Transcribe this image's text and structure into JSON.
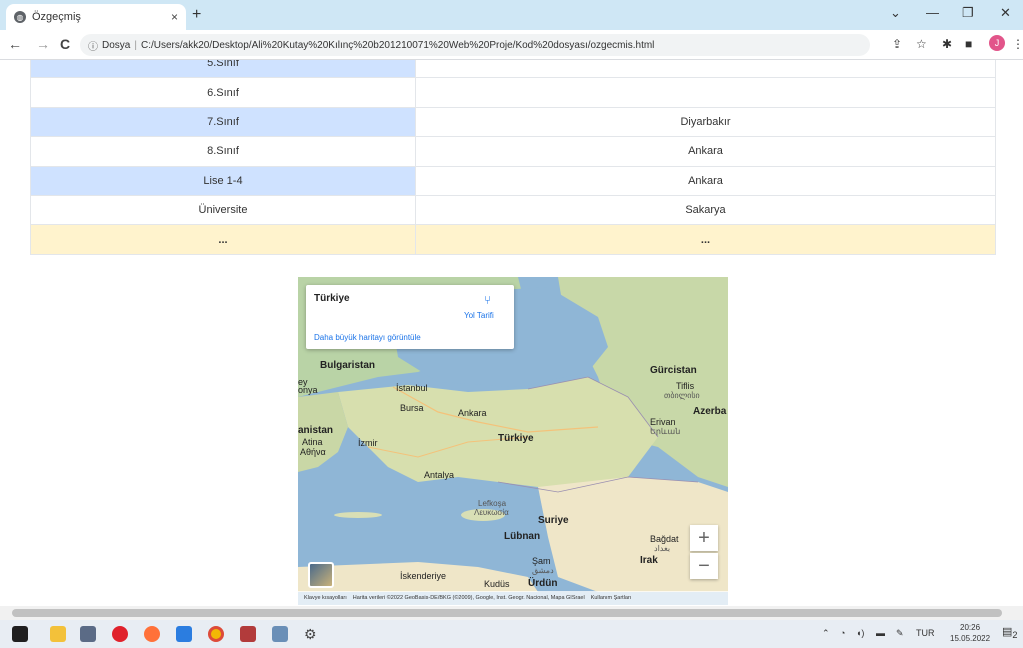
{
  "browser": {
    "tab_title": "Özgeçmiş",
    "tab_close": "×",
    "new_tab": "+",
    "window_controls": [
      "⌄",
      "—",
      "❐",
      "✕"
    ],
    "nav": {
      "back": "←",
      "forward": "→",
      "reload": "C"
    },
    "address": {
      "info_icon": "ⓘ",
      "scheme_label": "Dosya",
      "separator": "|",
      "url": "C:/Users/akk20/Desktop/Ali%20Kutay%20Kılınç%20b201210071%20Web%20Proje/Kod%20dosyası/ozgecmis.html"
    },
    "profile_initial": "J"
  },
  "education_table": {
    "rows": [
      {
        "level": "5.Sınıf",
        "city": "",
        "style": "blue"
      },
      {
        "level": "6.Sınıf",
        "city": "",
        "style": "white"
      },
      {
        "level": "7.Sınıf",
        "city": "Diyarbakır",
        "style": "blue"
      },
      {
        "level": "8.Sınıf",
        "city": "Ankara",
        "style": "white"
      },
      {
        "level": "Lise 1-4",
        "city": "Ankara",
        "style": "blue"
      },
      {
        "level": "Üniversite",
        "city": "Sakarya",
        "style": "white"
      },
      {
        "level": "...",
        "city": "...",
        "style": "yellow"
      }
    ]
  },
  "map": {
    "place_title": "Türkiye",
    "directions_label": "Yol Tarifi",
    "larger_map_link": "Daha büyük haritayı görüntüle",
    "zoom_in": "+",
    "zoom_out": "−",
    "labels": {
      "bulgaria": "Bulgaristan",
      "istanbul": "İstanbul",
      "bursa": "Bursa",
      "ankara": "Ankara",
      "turkey": "Türkiye",
      "georgia": "Gürcistan",
      "tbilisi": "Tiflis",
      "tbilisi_local": "თბილისი",
      "azerbaijan": "Azerba",
      "yerevan": "Erivan",
      "yerevan_local": "Երևան",
      "greece": "anistan",
      "athens": "Atina",
      "athens_local": "Αθήνα",
      "izmir": "İzmir",
      "antalya": "Antalya",
      "nicosia": "Lefkoşa",
      "nicosia_local": "Λευκωσία",
      "syria": "Suriye",
      "lebanon": "Lübnan",
      "baghdad": "Bağdat",
      "baghdad_local": "بغداد",
      "damascus": "Şam",
      "damascus_local": "دمشق",
      "iraq": "Irak",
      "alexandria": "İskenderiye",
      "jerusalem": "Kudüs",
      "jordan": "Ürdün",
      "edge_left1": "ey",
      "edge_left2": "onya"
    },
    "attribution": {
      "shortcuts": "Klavye kısayolları",
      "data": "Harita verileri ©2022 GeoBasis-DE/BKG (©2009), Google, Inst. Geogr. Nacional, Mapa GISrael",
      "terms": "Kullanım Şartları"
    }
  },
  "taskbar": {
    "language": "TUR",
    "time": "20:26",
    "date": "15.05.2022",
    "notifications_count": "2"
  },
  "colors": {
    "tabbar": "#cfe7f5",
    "row_blue": "#cfe2ff",
    "row_yellow": "#fff3cd",
    "link": "#1a73e8"
  }
}
